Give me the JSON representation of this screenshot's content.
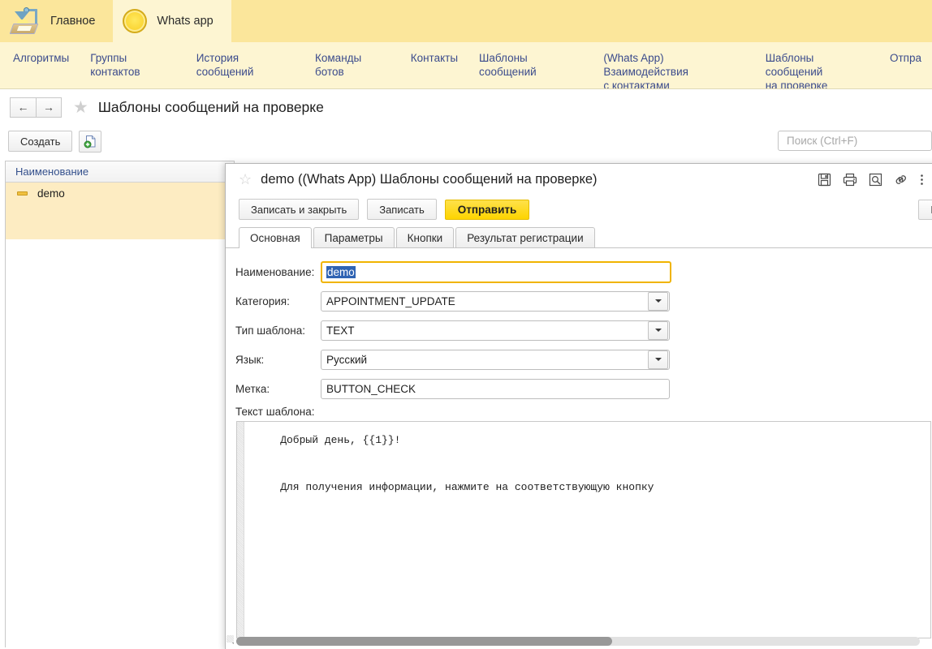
{
  "section_bar": {
    "tabs": [
      {
        "label": "Главное",
        "icon": "desk-lamp-icon",
        "active": false
      },
      {
        "label": "Whats app",
        "icon": "coin-icon",
        "active": true
      }
    ],
    "background_color": "#fbe69b",
    "active_tab_color": "#fdf5d2"
  },
  "nav_panel": {
    "items": [
      {
        "label": "Алгоритмы"
      },
      {
        "label": "Группы контактов"
      },
      {
        "label": "История сообщений"
      },
      {
        "label": "Команды ботов"
      },
      {
        "label": "Контакты"
      },
      {
        "label": "Шаблоны сообщений"
      },
      {
        "label": "(Whats App) Взаимодействия\nс контактами"
      },
      {
        "label": "Шаблоны сообщений\nна проверке"
      },
      {
        "label": "Отпра"
      }
    ],
    "link_color": "#3b4b8c",
    "background_color": "#fdf5d2"
  },
  "title_row": {
    "back_arrow": "←",
    "forward_arrow": "→",
    "favorite_icon": "star-icon",
    "title": "Шаблоны сообщений на проверке"
  },
  "command_bar": {
    "create_label": "Создать",
    "create_file_icon": "new-document-icon",
    "search": {
      "placeholder": "Поиск (Ctrl+F)",
      "value": ""
    }
  },
  "list_panel": {
    "column_header": "Наименование",
    "rows": [
      {
        "name": "demo",
        "selected": true
      }
    ],
    "selected_row_color": "#fdecc2"
  },
  "dialog": {
    "favorite_icon": "star-icon",
    "title": "demo ((Whats App) Шаблоны сообщений на проверке)",
    "title_icons": [
      {
        "name": "save-icon"
      },
      {
        "name": "print-icon"
      },
      {
        "name": "print-preview-icon"
      },
      {
        "name": "link-icon"
      },
      {
        "name": "more-menu-icon"
      }
    ],
    "buttons": {
      "save_close": "Записать и закрыть",
      "save": "Записать",
      "send": "Отправить",
      "more": "Е"
    },
    "send_button_color": "#fdd400",
    "tabs": [
      {
        "label": "Основная",
        "active": true
      },
      {
        "label": "Параметры",
        "active": false
      },
      {
        "label": "Кнопки",
        "active": false
      },
      {
        "label": "Результат регистрации",
        "active": false
      }
    ],
    "fields": [
      {
        "label": "Наименование:",
        "value": "demo",
        "type": "text",
        "focused": true,
        "selected": true
      },
      {
        "label": "Категория:",
        "value": "APPOINTMENT_UPDATE",
        "type": "select",
        "focused": false
      },
      {
        "label": "Тип шаблона:",
        "value": "TEXT",
        "type": "select",
        "focused": false
      },
      {
        "label": "Язык:",
        "value": "Русский",
        "type": "select",
        "focused": false
      },
      {
        "label": "Метка:",
        "value": "BUTTON_CHECK",
        "type": "text",
        "focused": false
      }
    ],
    "template_text": {
      "label": "Текст шаблона:",
      "value": "    Добрый день, {{1}}!\n\n    Для получения информации, нажмите на соответствующую кнопку"
    },
    "scrollbar": {
      "left_arrow": "◂",
      "thumb_position_percent": 0,
      "thumb_width_percent": 55
    }
  }
}
